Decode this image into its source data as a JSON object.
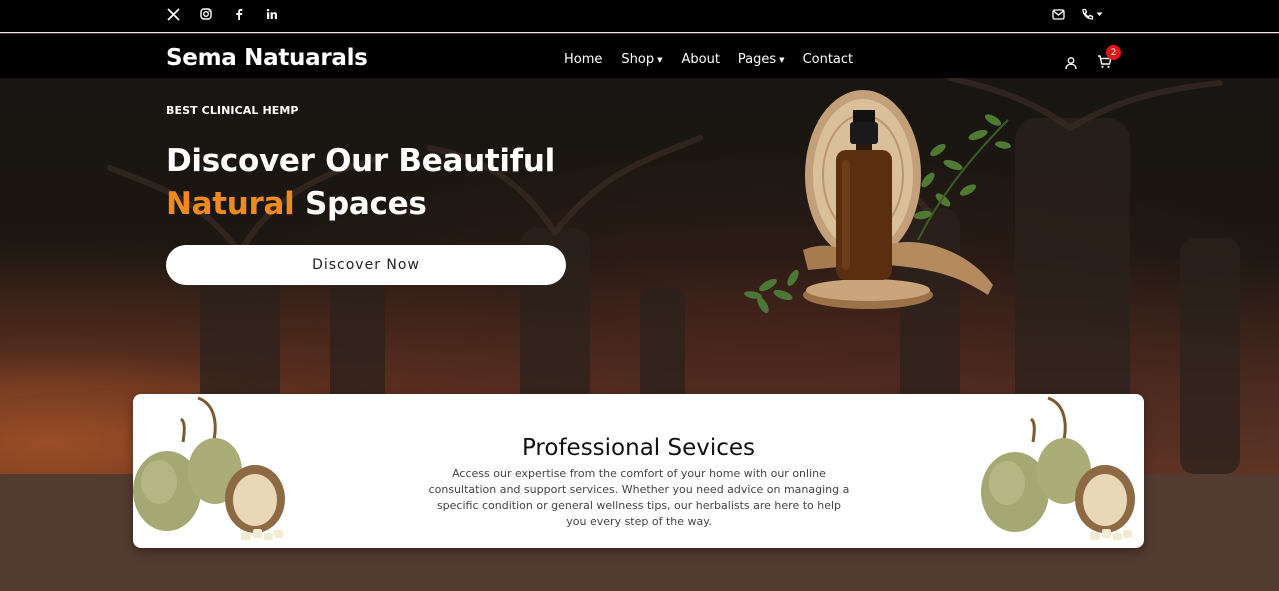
{
  "topbar": {
    "social_icons": [
      "x-icon",
      "instagram-icon",
      "facebook-icon",
      "linkedin-icon"
    ],
    "contact_icons": [
      "mail-icon",
      "phone-icon",
      "chevron-down-icon"
    ]
  },
  "nav": {
    "brand": "Sema Natuarals",
    "items": [
      {
        "label": "Home",
        "has_dropdown": false
      },
      {
        "label": "Shop",
        "has_dropdown": true
      },
      {
        "label": "About",
        "has_dropdown": false
      },
      {
        "label": "Pages",
        "has_dropdown": true
      },
      {
        "label": "Contact",
        "has_dropdown": false
      }
    ],
    "cart_count": "2"
  },
  "hero": {
    "kicker": "BEST CLINICAL HEMP",
    "headline_line1": "Discover Our Beautiful",
    "headline_accent": "Natural",
    "headline_line2_rest": " Spaces",
    "cta_label": "Discover Now"
  },
  "services": {
    "title": "Professional Sevices",
    "description": "Access our expertise from the comfort of your home with our online consultation and support services. Whether you need advice on managing a specific condition or general wellness tips, our herbalists are here to help you every step of the way."
  },
  "colors": {
    "accent": "#ef8a1f",
    "topbar_bg": "#000000",
    "band_brown": "#533b30",
    "badge_red": "#e31616"
  }
}
